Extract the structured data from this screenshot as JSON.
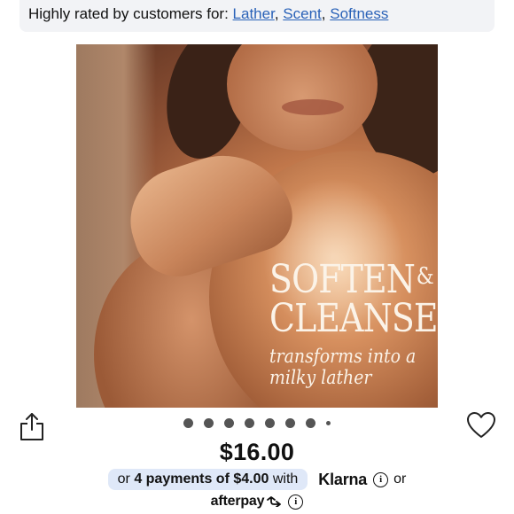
{
  "rating": {
    "prefix": "Highly rated by customers for:",
    "attributes": [
      "Lather",
      "Scent",
      "Softness"
    ]
  },
  "hero": {
    "headline_line1": "SOFTEN",
    "headline_amp": "&",
    "headline_line2": "CLEANSE",
    "sub_line1": "transforms into a",
    "sub_line2": "milky lather"
  },
  "carousel": {
    "dot_count": 8,
    "icon_share": "share-icon",
    "icon_wishlist": "heart-icon"
  },
  "product": {
    "price": "$16.00"
  },
  "payments": {
    "pill_prefix": "or",
    "installments": "4 payments of $4.00",
    "with_text": "with",
    "klarna_label": "Klarna",
    "or_text": "or",
    "afterpay_label": "afterpay"
  },
  "colors": {
    "link": "#2a62b8",
    "pill_bg": "#dfe8f8",
    "rating_bg": "#f2f3f6"
  }
}
